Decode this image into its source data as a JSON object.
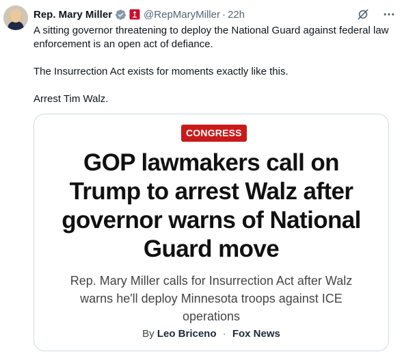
{
  "author": {
    "name": "Rep. Mary Miller",
    "handle": "@RepMaryMiller",
    "separator": "·",
    "time": "22h"
  },
  "tweet": {
    "paragraphs": [
      "A sitting governor threatening to deploy the National Guard against federal law enforcement is an open act of defiance.",
      "The Insurrection Act exists for moments exactly like this.",
      "Arrest Tim Walz."
    ]
  },
  "card": {
    "badge": "CONGRESS",
    "headline": "GOP lawmakers call on Trump to arrest Walz after governor warns of National Guard move",
    "subhead": "Rep. Mary Miller calls for Insurrection Act after Walz warns he'll deploy Minnesota troops against ICE operations",
    "by_prefix": "By",
    "author": "Leo Briceno",
    "separator": "·",
    "outlet": "Fox News"
  },
  "colors": {
    "badge_bg": "#c91a1a",
    "verified_gray": "#829aab",
    "secondary_text": "#536471"
  },
  "icons": [
    "verified-badge-icon",
    "congress-flag-icon",
    "grok-slash-icon",
    "more-icon"
  ]
}
